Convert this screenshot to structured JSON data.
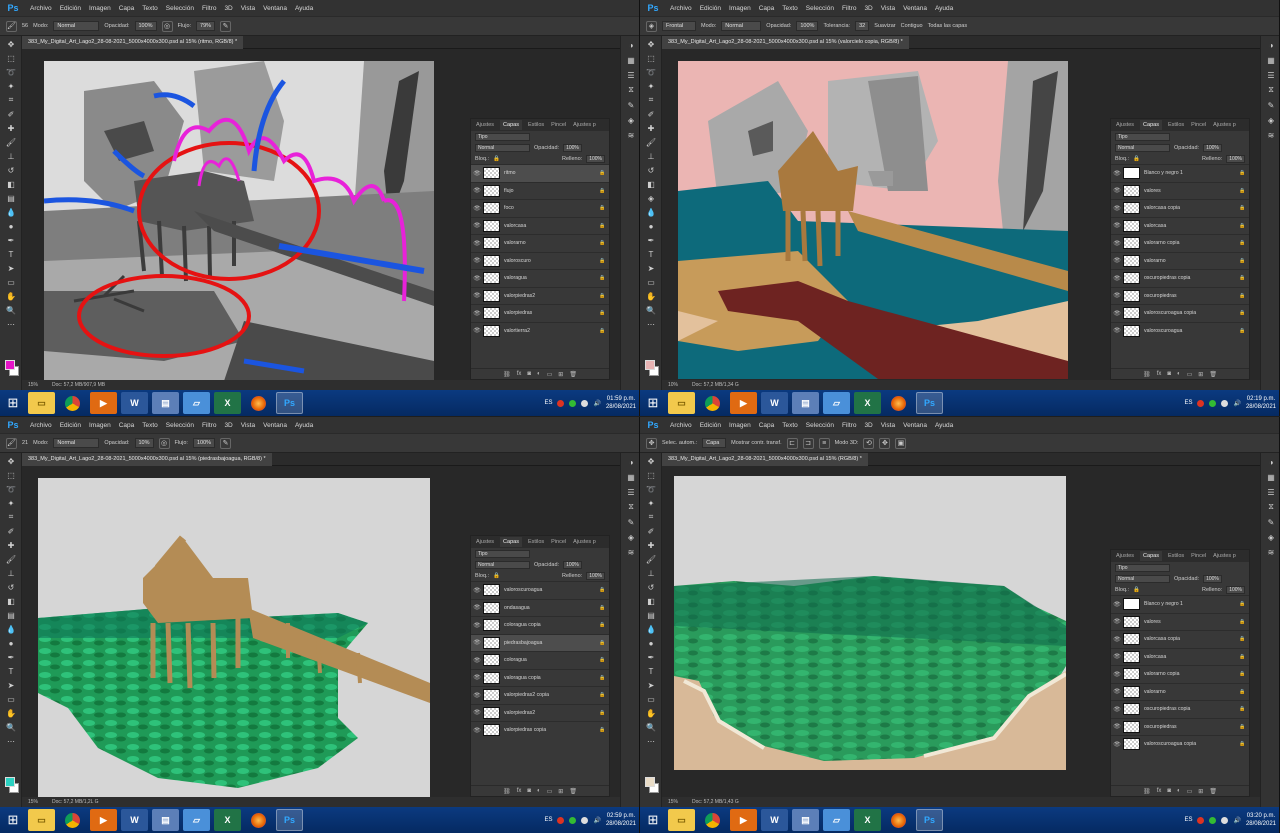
{
  "app": {
    "logo": "Ps"
  },
  "menu": [
    "Archivo",
    "Edición",
    "Imagen",
    "Capa",
    "Texto",
    "Selección",
    "Filtro",
    "3D",
    "Vista",
    "Ventana",
    "Ayuda"
  ],
  "colors": {
    "ps_blue": "#31a8ff",
    "taskbar": "#0b3a80",
    "panel": "#383838",
    "selected_layer": "#4d4d4d"
  },
  "panel_tabs": [
    "Ajustes",
    "Capas",
    "Estilos",
    "Pincel",
    "Ajustes p"
  ],
  "panel_common": {
    "kind_filter": "Tipo",
    "opacity_label": "Opacidad:",
    "lock_label": "Bloq.:",
    "fill_label": "Relleno:",
    "fx": "fx"
  },
  "taskbar": {
    "lang": "ES",
    "apps": [
      "explorer-icon",
      "chrome-icon",
      "media-icon",
      "word-icon",
      "notes-icon",
      "onenote-icon",
      "excel-icon",
      "firefox-icon",
      "photoshop-icon"
    ],
    "app_labels": {
      "word": "W",
      "excel": "X",
      "ps": "Ps"
    }
  },
  "quad1": {
    "options": {
      "brush_size": "56",
      "mode_label": "Modo:",
      "mode_value": "Normal",
      "opacity_label": "Opacidad:",
      "opacity_value": "100%",
      "flow_label": "Flujo:",
      "flow_value": "79%"
    },
    "doc_title": "383_My_Digital_Art_Lago2_28-08-2021_5000x4000x300.psd al 15% (ritmo, RGB/8) *",
    "status_zoom": "15%",
    "status_doc": "Doc: 57,2 MB/907,9 MB",
    "blend_mode": "Normal",
    "opacity": "100%",
    "fill": "100%",
    "layers": [
      {
        "name": "ritmo",
        "selected": true
      },
      {
        "name": "flujo",
        "selected": false
      },
      {
        "name": "foco",
        "selected": false
      },
      {
        "name": "valorcasa",
        "selected": false
      },
      {
        "name": "valorarno",
        "selected": false
      },
      {
        "name": "valoroscuro",
        "selected": false
      },
      {
        "name": "valoragua",
        "selected": false
      },
      {
        "name": "valorpiedras2",
        "selected": false
      },
      {
        "name": "valorpiedras",
        "selected": false
      },
      {
        "name": "valortierra2",
        "selected": false
      }
    ],
    "clock_time": "01:59 p.m.",
    "clock_date": "28/08/2021"
  },
  "quad2": {
    "options": {
      "shape_label": "Frontal",
      "mode_label": "Modo:",
      "mode_value": "Normal",
      "opacity_label": "Opacidad:",
      "opacity_value": "100%",
      "tolerance_label": "Tolerancia:",
      "tolerance_value": "32",
      "smooth_label": "Suavizar",
      "contiguous_label": "Contiguo",
      "all_layers_label": "Todas las capas"
    },
    "doc_title": "383_My_Digital_Art_Lago2_28-08-2021_5000x4000x300.psd al 15% (valorcielo copia, RGB/8) *",
    "status_zoom": "10%",
    "status_doc": "Doc: 57,2 MB/1,34 G",
    "blend_mode": "Normal",
    "opacity": "100%",
    "fill": "100%",
    "layers": [
      {
        "name": "Blanco y negro 1",
        "selected": false,
        "adjust": true
      },
      {
        "name": "valores",
        "selected": false
      },
      {
        "name": "valorcasa copia",
        "selected": false
      },
      {
        "name": "valorcasa",
        "selected": false
      },
      {
        "name": "valorarno copia",
        "selected": false
      },
      {
        "name": "valorarno",
        "selected": false
      },
      {
        "name": "oscuropiedras copia",
        "selected": false
      },
      {
        "name": "oscuropiedras",
        "selected": false
      },
      {
        "name": "valoroscuroagua copia",
        "selected": false
      },
      {
        "name": "valoroscuroagua",
        "selected": false
      }
    ],
    "clock_time": "02:19 p.m.",
    "clock_date": "28/08/2021"
  },
  "quad3": {
    "options": {
      "brush_size": "21",
      "mode_label": "Modo:",
      "mode_value": "Normal",
      "opacity_label": "Opacidad:",
      "opacity_value": "10%",
      "flow_label": "Flujo:",
      "flow_value": "100%"
    },
    "doc_title": "383_My_Digital_Art_Lago2_28-08-2021_5000x4000x300.psd al 15% (piedrasbajoagua, RGB/8) *",
    "status_zoom": "15%",
    "status_doc": "Doc: 57,2 MB/1,2L G",
    "blend_mode": "Normal",
    "opacity": "100%",
    "fill": "100%",
    "layers": [
      {
        "name": "valoroscuroagua",
        "selected": false
      },
      {
        "name": "ondasagua",
        "selected": false
      },
      {
        "name": "coloragua copia",
        "selected": false
      },
      {
        "name": "piedrasbajoagua",
        "selected": true
      },
      {
        "name": "coloragua",
        "selected": false
      },
      {
        "name": "valoragua copia",
        "selected": false
      },
      {
        "name": "valorpiedras2 copia",
        "selected": false
      },
      {
        "name": "valorpiedras2",
        "selected": false
      },
      {
        "name": "valorpiedras copia",
        "selected": false
      }
    ],
    "clock_time": "02:59 p.m.",
    "clock_date": "28/08/2021"
  },
  "quad4": {
    "options": {
      "autoselect_label": "Selec. autom.:",
      "autoselect_value": "Capa",
      "transform_label": "Mostrar contr. transf.",
      "mode_3d": "Modo 3D:"
    },
    "doc_title": "383_My_Digital_Art_Lago2_28-08-2021_5000x4000x300.psd al 15% (RGB/8) *",
    "status_zoom": "15%",
    "status_doc": "Doc: 57,2 MB/1,43 G",
    "blend_mode": "Normal",
    "opacity": "100%",
    "fill": "100%",
    "layers": [
      {
        "name": "Blanco y negro 1",
        "selected": false,
        "adjust": true
      },
      {
        "name": "valores",
        "selected": false
      },
      {
        "name": "valorcasa copia",
        "selected": false
      },
      {
        "name": "valorcasa",
        "selected": false
      },
      {
        "name": "valorarno copia",
        "selected": false
      },
      {
        "name": "valorarno",
        "selected": false
      },
      {
        "name": "oscuropiedras copia",
        "selected": false
      },
      {
        "name": "oscuropiedras",
        "selected": false
      },
      {
        "name": "valoroscuroagua copia",
        "selected": false
      }
    ],
    "clock_time": "03:20 p.m.",
    "clock_date": "28/08/2021"
  }
}
